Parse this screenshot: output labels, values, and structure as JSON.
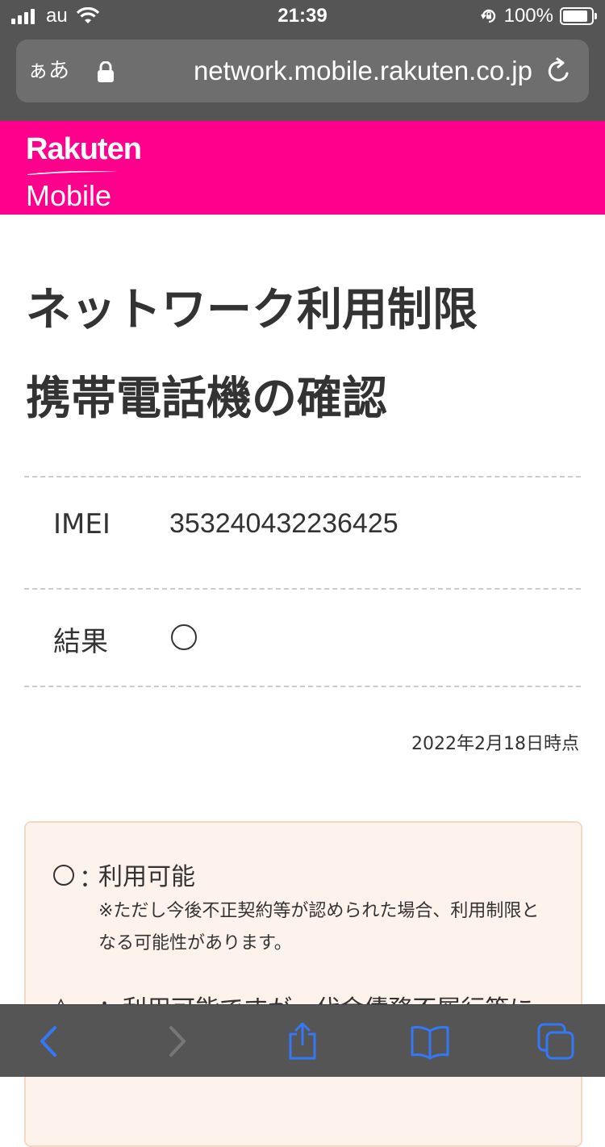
{
  "status_bar": {
    "carrier": "au",
    "time": "21:39",
    "battery_percent_text": "100%",
    "battery_level": 1.0,
    "icons": [
      "signal-icon",
      "wifi-icon",
      "orientation-lock-icon",
      "battery-icon"
    ]
  },
  "browser": {
    "reader_label": "ぁあ",
    "url": "network.mobile.rakuten.co.jp",
    "icons": [
      "lock-icon",
      "reload-icon"
    ]
  },
  "header": {
    "logo_line1": "Rakuten",
    "logo_line2": "Mobile",
    "brand_color": "#ff008c"
  },
  "main": {
    "title_line1": "ネットワーク利用制限",
    "title_line2": "携帯電話機の確認",
    "rows": [
      {
        "label": "IMEI",
        "value": "353240432236425"
      },
      {
        "label": "結果",
        "value_icon": "circle-mark-icon"
      }
    ],
    "as_of": "2022年2月18日時点",
    "legend": {
      "item1_label": "利用可能",
      "item1_colon": "：",
      "item1_note": "※ただし今後不正契約等が認められた場合、利用制限となる可能性があります。",
      "item2_symbol": "△",
      "item2_label": "：利用可能ですが、代金債務不履行等に",
      "box_bg": "#fdf2ec",
      "box_border": "#f6d8c4"
    }
  },
  "toolbar": {
    "icons": [
      "back-icon",
      "forward-icon",
      "share-icon",
      "bookmarks-icon",
      "tabs-icon"
    ],
    "accent": "#3478f6"
  }
}
